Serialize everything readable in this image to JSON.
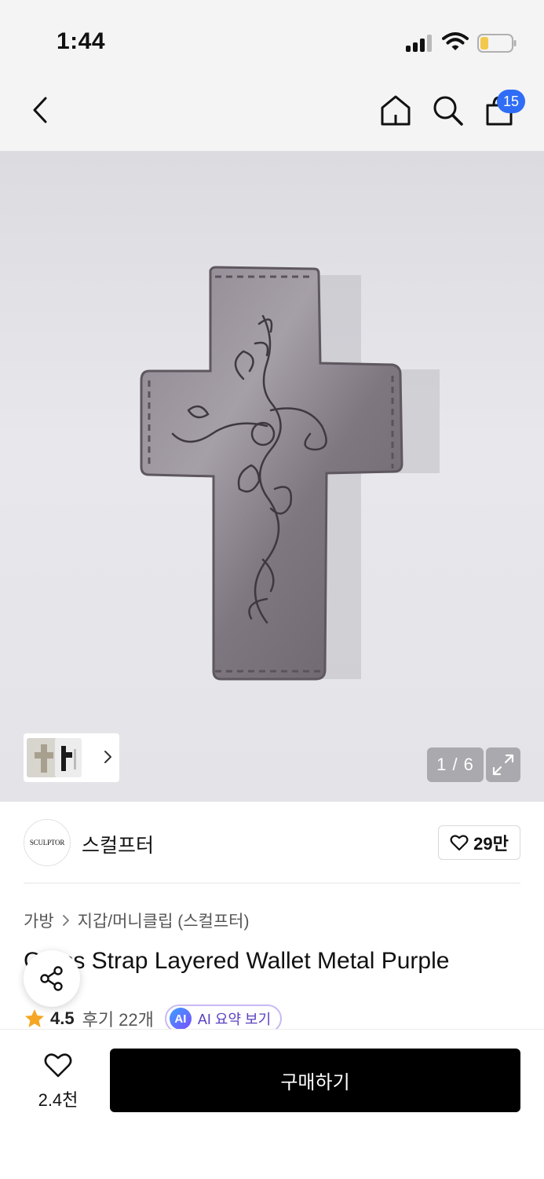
{
  "status_bar": {
    "time": "1:44",
    "icons": [
      "cellular-signal-icon",
      "wifi-icon",
      "battery-icon"
    ]
  },
  "nav": {
    "icons": [
      "back-chevron-icon",
      "home-icon",
      "search-icon",
      "shopping-bag-icon"
    ],
    "cart_badge": "15",
    "badge_color": "#2f6df6"
  },
  "gallery": {
    "counter": "1 / 6",
    "current_index": 1,
    "total": 6,
    "image_subject_icon": "leather-cross-wallet-image",
    "expand_icon": "expand-arrows-icon",
    "thumbs_arrow_icon": "chevron-right-icon"
  },
  "brand": {
    "logo_text": "SCULPTOR",
    "name": "스컬프터",
    "like_count": "29만",
    "like_icon": "heart-outline-icon"
  },
  "breadcrumb": {
    "items": [
      "가방",
      "지갑/머니클립 (스컬프터)"
    ]
  },
  "product": {
    "title": "Cross Strap Layered Wallet Metal Purple",
    "rating": "4.5",
    "review_link": "후기 22개",
    "ai_badge": "AI",
    "ai_summary": "AI 요약 보기",
    "star_color": "#f5a623",
    "share_icon": "share-icon"
  },
  "bottom_bar": {
    "wish_count": "2.4천",
    "buy_label": "구매하기"
  }
}
